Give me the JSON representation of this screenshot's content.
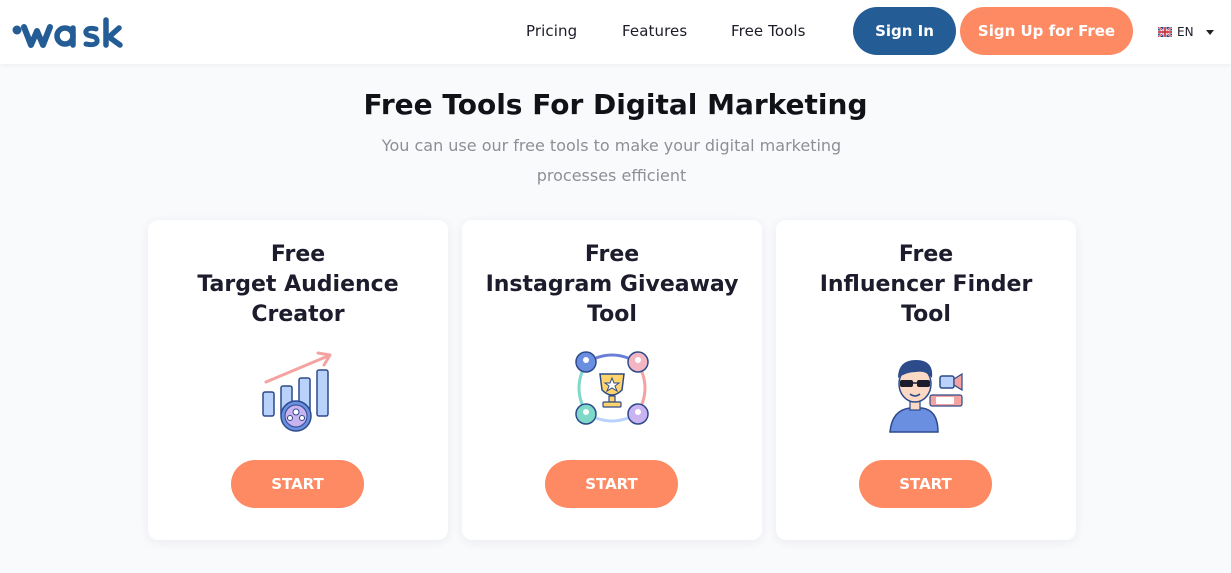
{
  "header": {
    "nav": [
      "Pricing",
      "Features",
      "Free Tools"
    ],
    "signin_label": "Sign In",
    "signup_label": "Sign Up for Free",
    "language": "EN"
  },
  "main": {
    "title": "Free Tools For Digital Marketing",
    "subtitle": "You can use our free tools to make your digital marketing processes efficient",
    "cards": [
      {
        "line1": "Free",
        "line2": "Target Audience",
        "line3": "Creator",
        "button": "START",
        "icon": "audience-chart-icon"
      },
      {
        "line1": "Free",
        "line2": "Instagram Giveaway",
        "line3": "Tool",
        "button": "START",
        "icon": "giveaway-trophy-icon"
      },
      {
        "line1": "Free",
        "line2": "Influencer Finder",
        "line3": "Tool",
        "button": "START",
        "icon": "influencer-icon"
      }
    ]
  },
  "colors": {
    "brand_blue": "#245d95",
    "accent_orange": "#fd8a62"
  }
}
